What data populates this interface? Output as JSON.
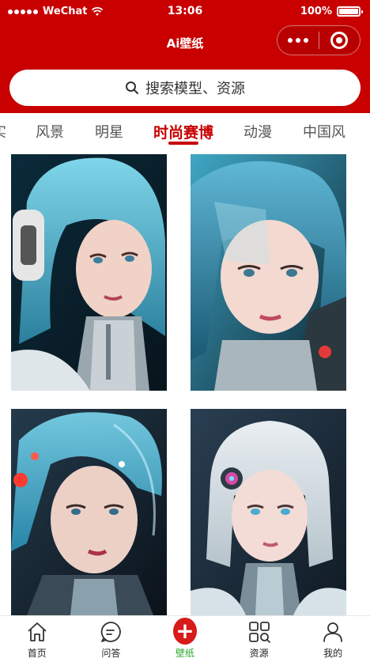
{
  "status_bar": {
    "carrier": "WeChat",
    "time": "13:06",
    "battery": "100%"
  },
  "nav": {
    "title": "Ai壁纸"
  },
  "search": {
    "placeholder": "搜索模型、资源"
  },
  "tabs": [
    {
      "label": "实",
      "active": false
    },
    {
      "label": "风景",
      "active": false
    },
    {
      "label": "明星",
      "active": false
    },
    {
      "label": "时尚赛博",
      "active": true
    },
    {
      "label": "动漫",
      "active": false
    },
    {
      "label": "中国风",
      "active": false
    }
  ],
  "grid": {
    "items": [
      {
        "subject": "cyber girl with blue hair and headphones",
        "accent": "#4fb9d6"
      },
      {
        "subject": "cyber girl with teal hair in glass helmet",
        "accent": "#3aa6c4"
      },
      {
        "subject": "cyber girl in transparent helmet with red lights",
        "accent": "#59c6e8"
      },
      {
        "subject": "silver-haired cyber girl with ear device",
        "accent": "#8fd3e8"
      }
    ]
  },
  "tabbar": {
    "items": [
      {
        "label": "首页",
        "icon": "home-icon",
        "active": false
      },
      {
        "label": "问答",
        "icon": "chat-bubble-icon",
        "active": false
      },
      {
        "label": "壁纸",
        "icon": "plus-icon",
        "active": true
      },
      {
        "label": "资源",
        "icon": "grid-search-icon",
        "active": false
      },
      {
        "label": "我的",
        "icon": "user-icon",
        "active": false
      }
    ]
  },
  "colors": {
    "brand_red": "#c80000",
    "active_tab_green": "#2aa52a",
    "plus_red": "#d71a1a"
  }
}
